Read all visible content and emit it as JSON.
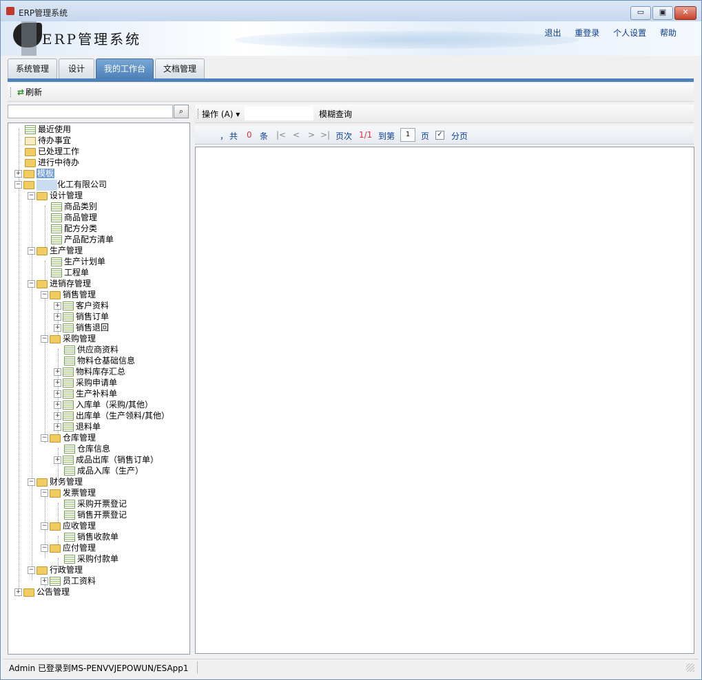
{
  "window": {
    "title": "ERP管理系统",
    "buttons": {
      "minimize": "▭",
      "maximize": "▣",
      "close": "✕"
    }
  },
  "banner": {
    "logo_text": "ERP管理系统",
    "links": [
      "退出",
      "重登录",
      "个人设置",
      "帮助"
    ]
  },
  "tabs": [
    {
      "label": "系统管理"
    },
    {
      "label": "设计"
    },
    {
      "label": "我的工作台",
      "active": true
    },
    {
      "label": "文档管理"
    }
  ],
  "toolbar": {
    "refresh_label": "刷新",
    "search_icon": "search-icon"
  },
  "tree": {
    "recent": "最近使用",
    "todo": "待办事宜",
    "done": "已处理工作",
    "in_progress": "进行中待办",
    "template": "模板",
    "company": "化工有限公司",
    "design": "设计管理",
    "d1": "商品类别",
    "d2": "商品管理",
    "d3": "配方分类",
    "d4": "产品配方清单",
    "production": "生产管理",
    "p1": "生产计划单",
    "p2": "工程单",
    "jxc": "进销存管理",
    "sales": "销售管理",
    "s1": "客户资料",
    "s2": "销售订单",
    "s3": "销售退回",
    "purchase": "采购管理",
    "pu1": "供应商资料",
    "pu2": "物料仓基础信息",
    "pu3": "物料库存汇总",
    "pu4": "采购申请单",
    "pu5": "生产补料单",
    "pu6": "入库单（采购/其他）",
    "pu7": "出库单（生产领料/其他）",
    "pu8": "退料单",
    "warehouse": "仓库管理",
    "w1": "仓库信息",
    "w2": "成品出库（销售订单）",
    "w3": "成品入库（生产）",
    "finance": "财务管理",
    "invoice": "发票管理",
    "i1": "采购开票登记",
    "i2": "销售开票登记",
    "receivable": "应收管理",
    "r1": "销售收款单",
    "payable": "应付管理",
    "y1": "采购付款单",
    "admin": "行政管理",
    "a1": "员工资料",
    "notice": "公告管理"
  },
  "right_toolbar": {
    "operation": "操作 (A) ▾",
    "fuzzy_query": "模糊查询"
  },
  "pager": {
    "comma": "，",
    "total_prefix": "共",
    "total": "0",
    "total_suffix": "条",
    "first": "|<",
    "prev": "<",
    "next": ">",
    "last": ">|",
    "page_label": "页次",
    "page_value": "1/1",
    "goto_label": "到第",
    "goto_value": "1",
    "page_suffix": "页",
    "paginate_label": "分页",
    "paginate_checked": "✓"
  },
  "status": {
    "text": "Admin 已登录到MS-PENVVJEPOWUN/ESApp1"
  }
}
